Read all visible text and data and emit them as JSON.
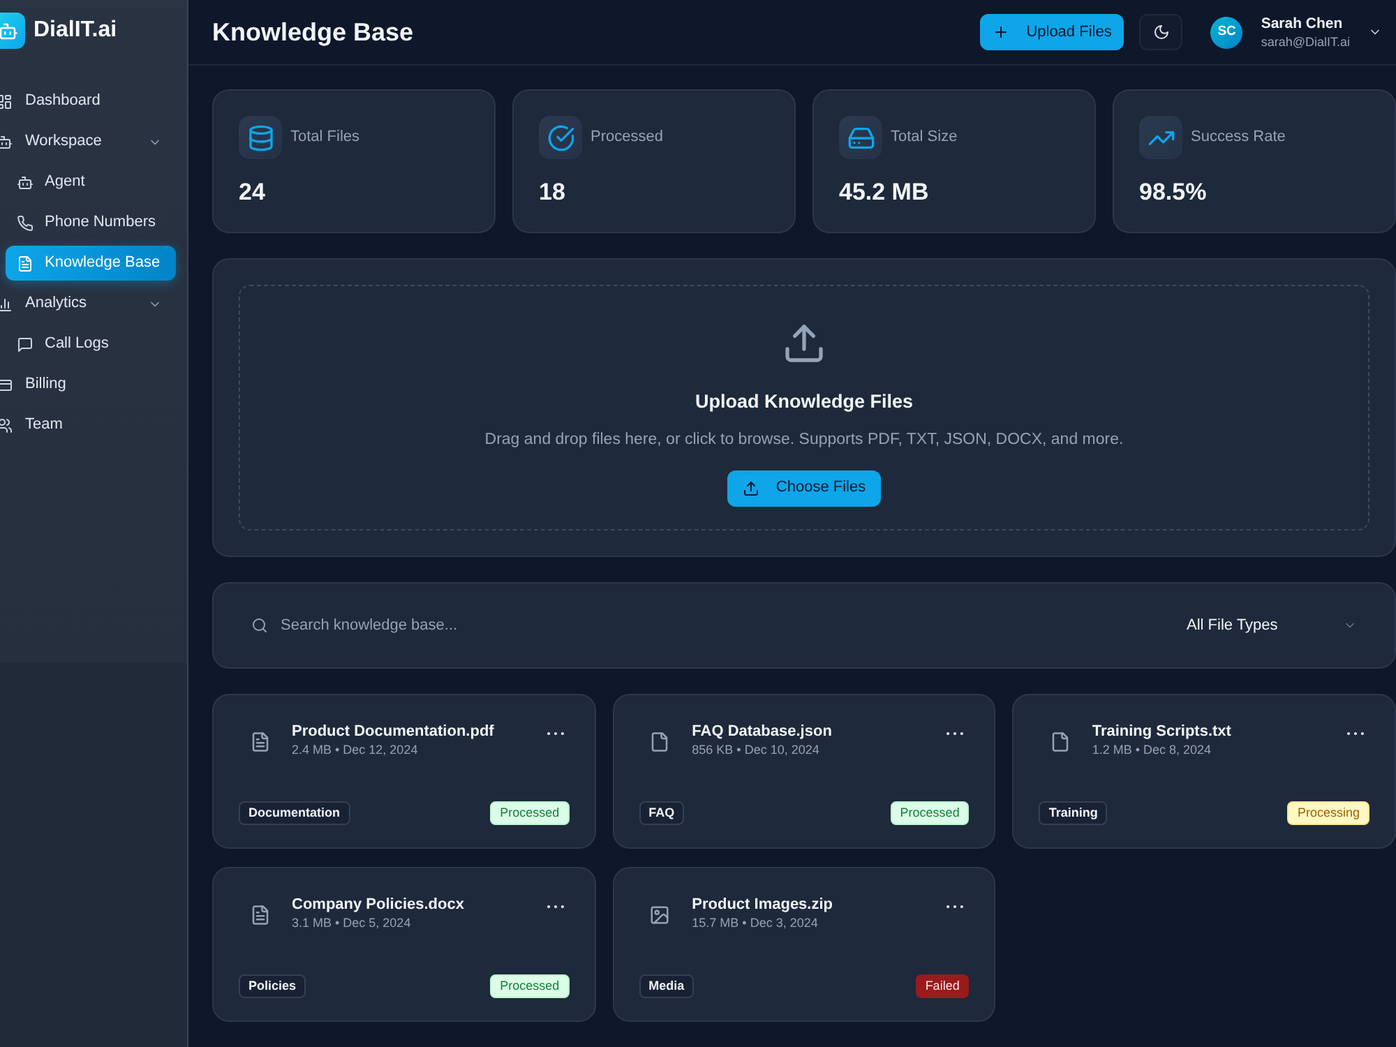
{
  "sidebar": {
    "brand": "DialIT.ai",
    "items": [
      {
        "label": "Dashboard",
        "selected": false
      },
      {
        "label": "Workspace",
        "selected": false,
        "expanded": true,
        "children": [
          {
            "label": "Agent",
            "selected": false
          },
          {
            "label": "Phone Numbers",
            "selected": false
          },
          {
            "label": "Knowledge Base",
            "selected": true
          }
        ]
      },
      {
        "label": "Analytics",
        "selected": false,
        "expanded": true,
        "children": [
          {
            "label": "Call Logs",
            "selected": false
          }
        ]
      },
      {
        "label": "Billing",
        "selected": false
      },
      {
        "label": "Team",
        "selected": false
      }
    ]
  },
  "header": {
    "title": "Knowledge Base",
    "upload_button": "Upload Files",
    "user": {
      "initials": "SC",
      "name": "Sarah Chen",
      "email": "sarah@DialIT.ai"
    }
  },
  "stats": [
    {
      "label": "Total Files",
      "value": "24"
    },
    {
      "label": "Processed",
      "value": "18"
    },
    {
      "label": "Total Size",
      "value": "45.2 MB"
    },
    {
      "label": "Success Rate",
      "value": "98.5%"
    }
  ],
  "upload": {
    "title": "Upload Knowledge Files",
    "description": "Drag and drop files here, or click to browse. Supports PDF, TXT, JSON, DOCX, and more.",
    "button": "Choose Files"
  },
  "filters": {
    "search": {
      "placeholder": "Search knowledge base..."
    },
    "file_type": "All File Types"
  },
  "files": [
    {
      "kind": "document",
      "name": "Product Documentation.pdf",
      "meta": "2.4 MB • Dec 12, 2024",
      "tag": "Documentation",
      "status": {
        "kind": "success",
        "label": "Processed"
      }
    },
    {
      "kind": "file",
      "name": "FAQ Database.json",
      "meta": "856 KB • Dec 10, 2024",
      "tag": "FAQ",
      "status": {
        "kind": "success",
        "label": "Processed"
      }
    },
    {
      "kind": "file",
      "name": "Training Scripts.txt",
      "meta": "1.2 MB • Dec 8, 2024",
      "tag": "Training",
      "status": {
        "kind": "warning",
        "label": "Processing"
      }
    },
    {
      "kind": "document",
      "name": "Company Policies.docx",
      "meta": "3.1 MB • Dec 5, 2024",
      "tag": "Policies",
      "status": {
        "kind": "success",
        "label": "Processed"
      }
    },
    {
      "kind": "image",
      "name": "Product Images.zip",
      "meta": "15.7 MB • Dec 3, 2024",
      "tag": "Media",
      "status": {
        "kind": "error",
        "label": "Failed"
      }
    }
  ]
}
